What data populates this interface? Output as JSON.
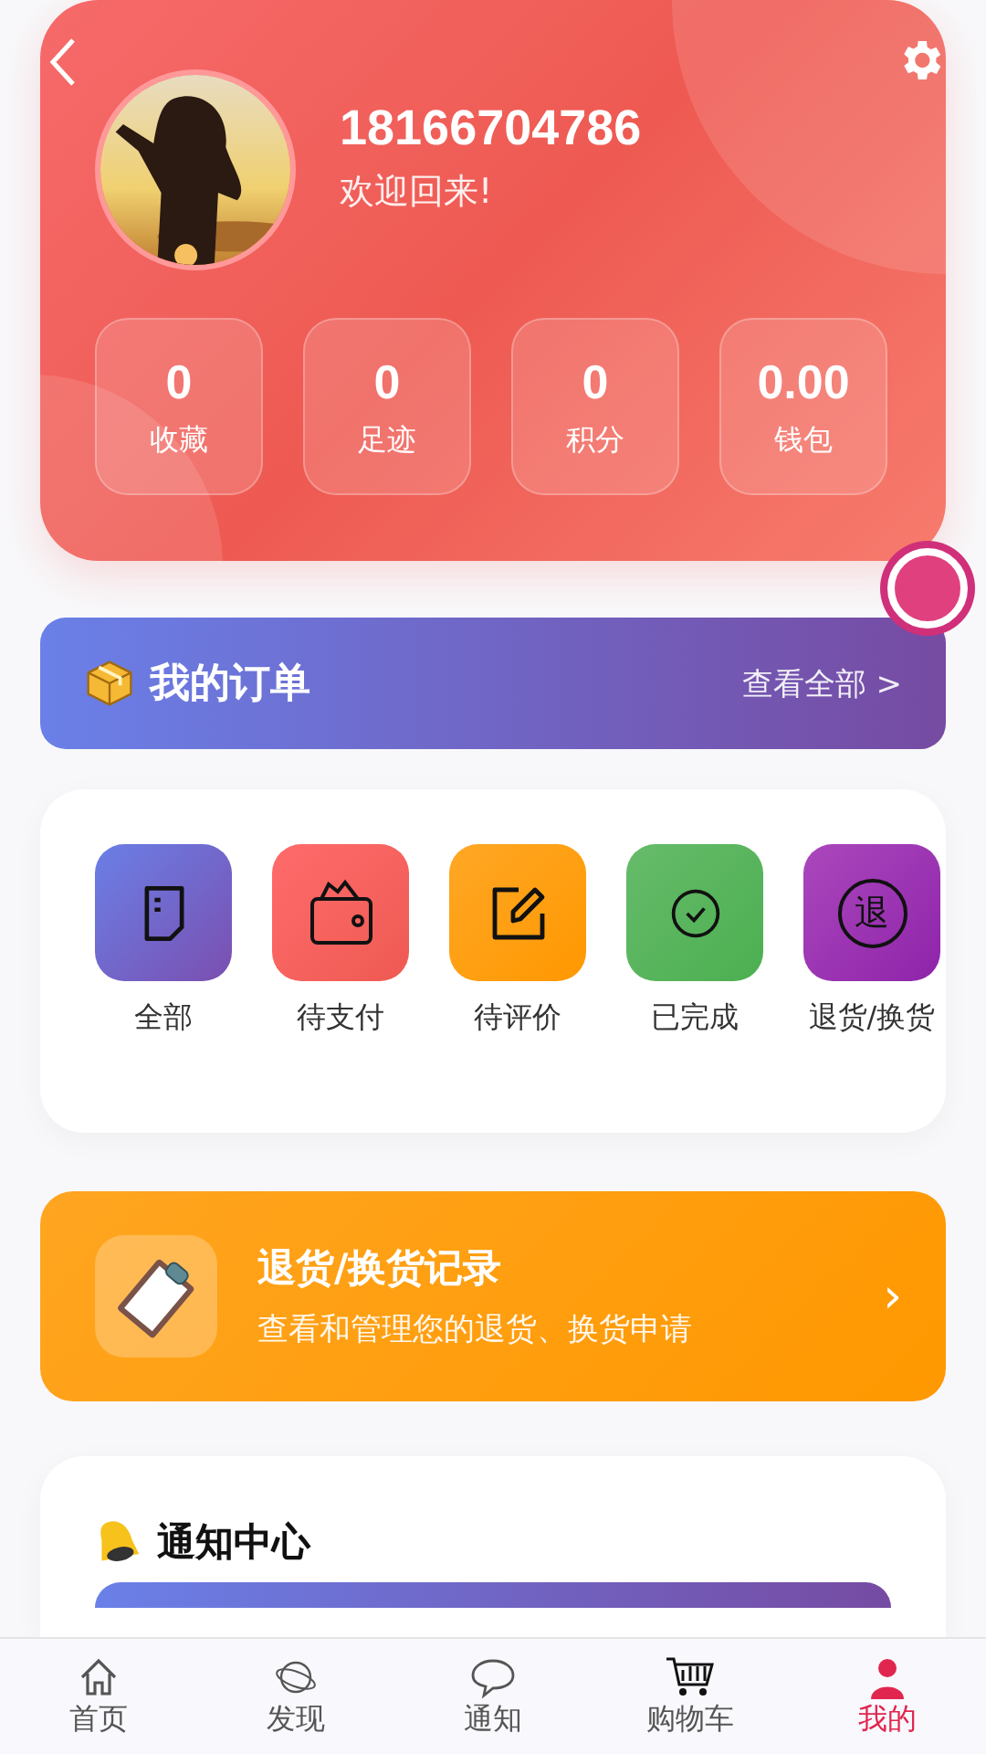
{
  "header": {
    "phone": "18166704786",
    "greeting": "欢迎回来!",
    "stats": [
      {
        "value": "0",
        "label": "收藏"
      },
      {
        "value": "0",
        "label": "足迹"
      },
      {
        "value": "0",
        "label": "积分"
      },
      {
        "value": "0.00",
        "label": "钱包"
      }
    ]
  },
  "orders": {
    "title": "我的订单",
    "view_all": "查看全部 >",
    "items": [
      {
        "kind": "all",
        "label": "全部"
      },
      {
        "kind": "pay",
        "label": "待支付"
      },
      {
        "kind": "review",
        "label": "待评价"
      },
      {
        "kind": "done",
        "label": "已完成"
      },
      {
        "kind": "refund",
        "label": "退货/换货",
        "glyph": "退"
      }
    ]
  },
  "returns": {
    "title": "退货/换货记录",
    "subtitle": "查看和管理您的退货、换货申请",
    "chevron": "›"
  },
  "notifications": {
    "title": "通知中心"
  },
  "tab_bar": [
    {
      "kind": "home",
      "label": "首页",
      "selected": false
    },
    {
      "kind": "discover",
      "label": "发现",
      "selected": false
    },
    {
      "kind": "chat",
      "label": "通知",
      "selected": false
    },
    {
      "kind": "cart",
      "label": "购物车",
      "selected": false
    },
    {
      "kind": "me",
      "label": "我的",
      "selected": true
    }
  ]
}
